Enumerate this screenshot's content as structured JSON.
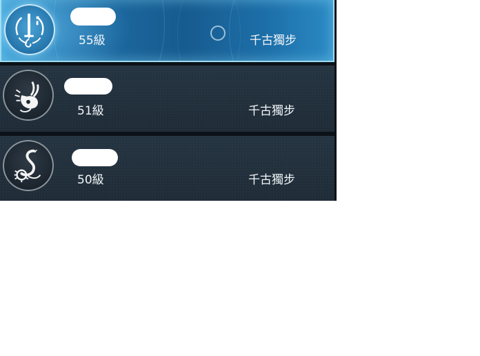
{
  "rows": [
    {
      "level": "55級",
      "title": "千古獨步",
      "emblem_icon": "sword-crest-icon",
      "selected": true
    },
    {
      "level": "51級",
      "title": "千古獨步",
      "emblem_icon": "rabbit-crest-icon",
      "selected": false
    },
    {
      "level": "50級",
      "title": "千古獨步",
      "emblem_icon": "serpent-crest-icon",
      "selected": false
    }
  ],
  "colors": {
    "selected_row": "#1d6fa9",
    "row_background": "#233240",
    "text": "#f2f6f8"
  }
}
